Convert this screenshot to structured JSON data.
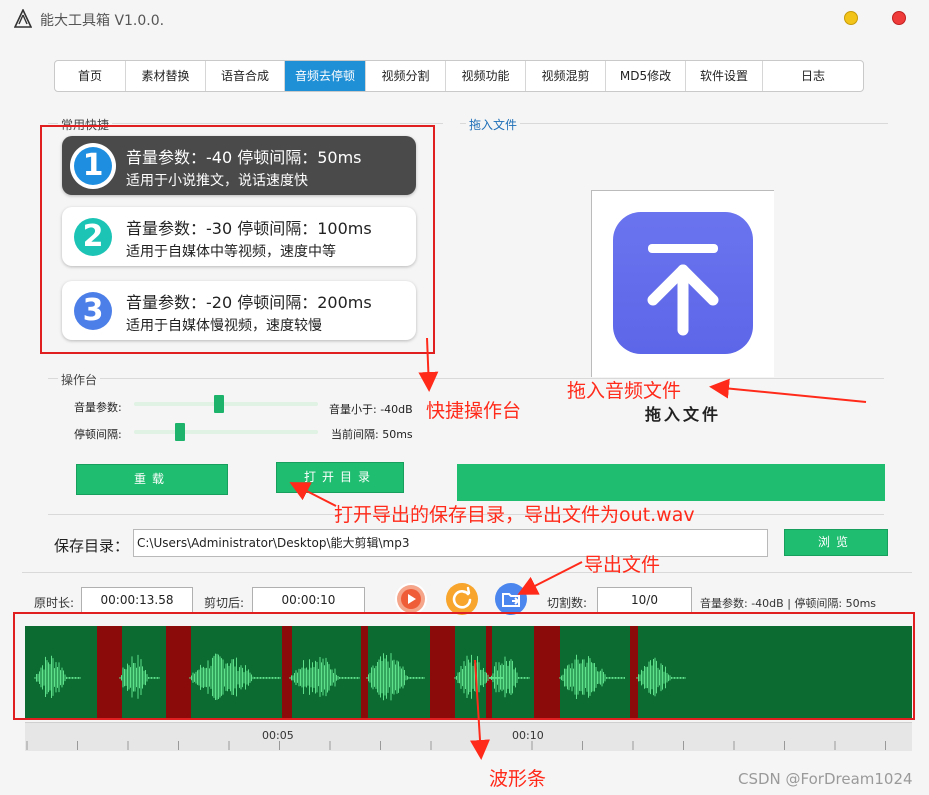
{
  "app": {
    "title": "能大工具箱 V1.0.0."
  },
  "tabs": [
    {
      "label": "首页",
      "active": false
    },
    {
      "label": "素材替换",
      "active": false
    },
    {
      "label": "语音合成",
      "active": false
    },
    {
      "label": "音频去停顿",
      "active": true
    },
    {
      "label": "视频分割",
      "active": false
    },
    {
      "label": "视频功能",
      "active": false
    },
    {
      "label": "视频混剪",
      "active": false
    },
    {
      "label": "MD5修改",
      "active": false
    },
    {
      "label": "软件设置",
      "active": false
    },
    {
      "label": "日志",
      "active": false
    }
  ],
  "shortcuts": {
    "section_label": "常用快捷",
    "cards": [
      {
        "number": "1",
        "line1": "音量参数：-40  停顿间隔：50ms",
        "line2": "适用于小说推文，说话速度快",
        "color": "#1e8fe0"
      },
      {
        "number": "2",
        "line1": "音量参数：-30  停顿间隔：100ms",
        "line2": "适用于自媒体中等视频，速度中等",
        "color": "#1cc4b6"
      },
      {
        "number": "3",
        "line1": "音量参数：-20  停顿间隔：200ms",
        "line2": "适用于自媒体慢视频，速度较慢",
        "color": "#4d7fe8"
      }
    ]
  },
  "drop": {
    "section_label": "拖入文件",
    "caption": "拖入文件"
  },
  "console": {
    "section_label": "操作台",
    "volume_label": "音量参数:",
    "volume_value_text": "音量小于: -40dB",
    "volume_level": 0.46,
    "pause_label": "停顿间隔:",
    "pause_value_text": "当前间隔: 50ms",
    "pause_level": 0.25,
    "reset_button": "重载",
    "open_dir_button": "打开目录"
  },
  "save": {
    "label": "保存目录：",
    "path": "C:\\Users\\Administrator\\Desktop\\能大剪辑\\mp3",
    "browse_button": "浏览"
  },
  "info": {
    "original_label": "原时长:",
    "original_value": "00:00:13.58",
    "cut_label": "剪切后:",
    "cut_value": "00:00:10",
    "segments_label": "切割数:",
    "segments_value": "10/0",
    "params_text": "音量参数: -40dB | 停顿间隔: 50ms"
  },
  "timeline": {
    "ticks": [
      "00:05",
      "00:10"
    ]
  },
  "annotations": {
    "quick_console": "快捷操作台",
    "drag_audio": "拖入音频文件",
    "open_dir": "打开导出的保存目录，导出文件为out.wav",
    "export": "导出文件",
    "waveform": "波形条"
  },
  "watermark": "CSDN @ForDream1024",
  "colors": {
    "accent_green": "#1fbd70",
    "active_tab": "#1f8fd6",
    "annotation_red": "#ff2a1a",
    "wave_bg": "#0b6b31",
    "wave_cut": "#8b0a0a",
    "wave_fg": "#5fe08a"
  }
}
